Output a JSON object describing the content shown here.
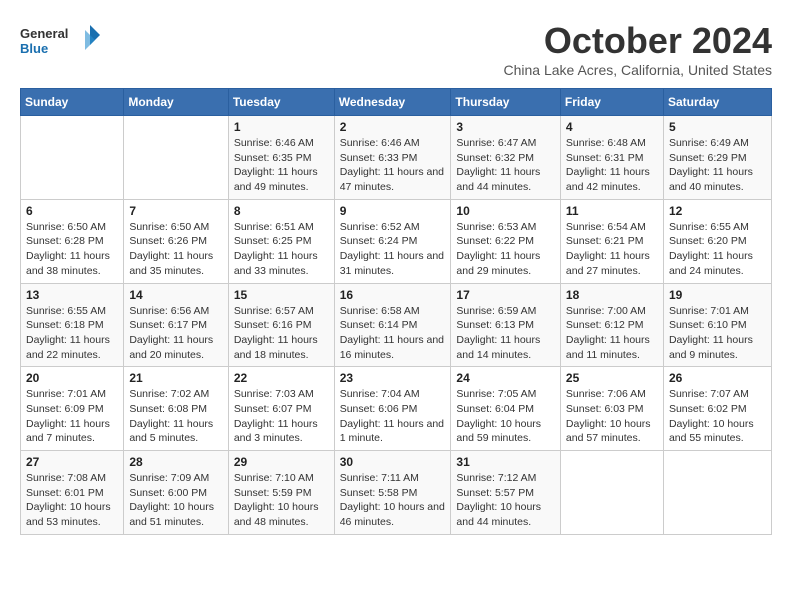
{
  "logo": {
    "general": "General",
    "blue": "Blue"
  },
  "title": "October 2024",
  "subtitle": "China Lake Acres, California, United States",
  "days_of_week": [
    "Sunday",
    "Monday",
    "Tuesday",
    "Wednesday",
    "Thursday",
    "Friday",
    "Saturday"
  ],
  "weeks": [
    [
      {
        "day": "",
        "detail": ""
      },
      {
        "day": "",
        "detail": ""
      },
      {
        "day": "1",
        "detail": "Sunrise: 6:46 AM\nSunset: 6:35 PM\nDaylight: 11 hours and 49 minutes."
      },
      {
        "day": "2",
        "detail": "Sunrise: 6:46 AM\nSunset: 6:33 PM\nDaylight: 11 hours and 47 minutes."
      },
      {
        "day": "3",
        "detail": "Sunrise: 6:47 AM\nSunset: 6:32 PM\nDaylight: 11 hours and 44 minutes."
      },
      {
        "day": "4",
        "detail": "Sunrise: 6:48 AM\nSunset: 6:31 PM\nDaylight: 11 hours and 42 minutes."
      },
      {
        "day": "5",
        "detail": "Sunrise: 6:49 AM\nSunset: 6:29 PM\nDaylight: 11 hours and 40 minutes."
      }
    ],
    [
      {
        "day": "6",
        "detail": "Sunrise: 6:50 AM\nSunset: 6:28 PM\nDaylight: 11 hours and 38 minutes."
      },
      {
        "day": "7",
        "detail": "Sunrise: 6:50 AM\nSunset: 6:26 PM\nDaylight: 11 hours and 35 minutes."
      },
      {
        "day": "8",
        "detail": "Sunrise: 6:51 AM\nSunset: 6:25 PM\nDaylight: 11 hours and 33 minutes."
      },
      {
        "day": "9",
        "detail": "Sunrise: 6:52 AM\nSunset: 6:24 PM\nDaylight: 11 hours and 31 minutes."
      },
      {
        "day": "10",
        "detail": "Sunrise: 6:53 AM\nSunset: 6:22 PM\nDaylight: 11 hours and 29 minutes."
      },
      {
        "day": "11",
        "detail": "Sunrise: 6:54 AM\nSunset: 6:21 PM\nDaylight: 11 hours and 27 minutes."
      },
      {
        "day": "12",
        "detail": "Sunrise: 6:55 AM\nSunset: 6:20 PM\nDaylight: 11 hours and 24 minutes."
      }
    ],
    [
      {
        "day": "13",
        "detail": "Sunrise: 6:55 AM\nSunset: 6:18 PM\nDaylight: 11 hours and 22 minutes."
      },
      {
        "day": "14",
        "detail": "Sunrise: 6:56 AM\nSunset: 6:17 PM\nDaylight: 11 hours and 20 minutes."
      },
      {
        "day": "15",
        "detail": "Sunrise: 6:57 AM\nSunset: 6:16 PM\nDaylight: 11 hours and 18 minutes."
      },
      {
        "day": "16",
        "detail": "Sunrise: 6:58 AM\nSunset: 6:14 PM\nDaylight: 11 hours and 16 minutes."
      },
      {
        "day": "17",
        "detail": "Sunrise: 6:59 AM\nSunset: 6:13 PM\nDaylight: 11 hours and 14 minutes."
      },
      {
        "day": "18",
        "detail": "Sunrise: 7:00 AM\nSunset: 6:12 PM\nDaylight: 11 hours and 11 minutes."
      },
      {
        "day": "19",
        "detail": "Sunrise: 7:01 AM\nSunset: 6:10 PM\nDaylight: 11 hours and 9 minutes."
      }
    ],
    [
      {
        "day": "20",
        "detail": "Sunrise: 7:01 AM\nSunset: 6:09 PM\nDaylight: 11 hours and 7 minutes."
      },
      {
        "day": "21",
        "detail": "Sunrise: 7:02 AM\nSunset: 6:08 PM\nDaylight: 11 hours and 5 minutes."
      },
      {
        "day": "22",
        "detail": "Sunrise: 7:03 AM\nSunset: 6:07 PM\nDaylight: 11 hours and 3 minutes."
      },
      {
        "day": "23",
        "detail": "Sunrise: 7:04 AM\nSunset: 6:06 PM\nDaylight: 11 hours and 1 minute."
      },
      {
        "day": "24",
        "detail": "Sunrise: 7:05 AM\nSunset: 6:04 PM\nDaylight: 10 hours and 59 minutes."
      },
      {
        "day": "25",
        "detail": "Sunrise: 7:06 AM\nSunset: 6:03 PM\nDaylight: 10 hours and 57 minutes."
      },
      {
        "day": "26",
        "detail": "Sunrise: 7:07 AM\nSunset: 6:02 PM\nDaylight: 10 hours and 55 minutes."
      }
    ],
    [
      {
        "day": "27",
        "detail": "Sunrise: 7:08 AM\nSunset: 6:01 PM\nDaylight: 10 hours and 53 minutes."
      },
      {
        "day": "28",
        "detail": "Sunrise: 7:09 AM\nSunset: 6:00 PM\nDaylight: 10 hours and 51 minutes."
      },
      {
        "day": "29",
        "detail": "Sunrise: 7:10 AM\nSunset: 5:59 PM\nDaylight: 10 hours and 48 minutes."
      },
      {
        "day": "30",
        "detail": "Sunrise: 7:11 AM\nSunset: 5:58 PM\nDaylight: 10 hours and 46 minutes."
      },
      {
        "day": "31",
        "detail": "Sunrise: 7:12 AM\nSunset: 5:57 PM\nDaylight: 10 hours and 44 minutes."
      },
      {
        "day": "",
        "detail": ""
      },
      {
        "day": "",
        "detail": ""
      }
    ]
  ]
}
